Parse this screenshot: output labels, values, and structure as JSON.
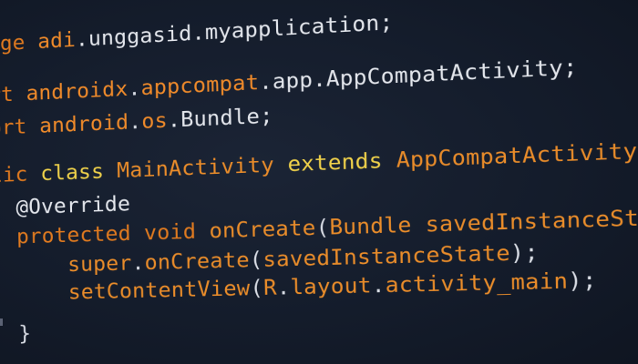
{
  "editor": {
    "lines": [
      {
        "id": "l1",
        "parts": [
          {
            "t": "age ",
            "c": "kw"
          },
          {
            "t": "adi",
            "c": "pk"
          },
          {
            "t": ".unggasid.myapplication;",
            "c": "id"
          }
        ]
      },
      {
        "id": "l2",
        "parts": [
          {
            "t": "rt ",
            "c": "kw"
          },
          {
            "t": "androidx",
            "c": "pk"
          },
          {
            "t": ".",
            "c": "pn"
          },
          {
            "t": "appcompat",
            "c": "pk"
          },
          {
            "t": ".app.AppCompatActivity;",
            "c": "id"
          }
        ]
      },
      {
        "id": "l3",
        "parts": [
          {
            "t": "ort ",
            "c": "kw"
          },
          {
            "t": "android",
            "c": "pk"
          },
          {
            "t": ".",
            "c": "pn"
          },
          {
            "t": "os",
            "c": "pk"
          },
          {
            "t": ".Bundle;",
            "c": "id"
          }
        ]
      },
      {
        "id": "l4",
        "parts": [
          {
            "t": "lic ",
            "c": "kw"
          },
          {
            "t": "class ",
            "c": "cls"
          },
          {
            "t": "MainActivity ",
            "c": "ty"
          },
          {
            "t": "extends ",
            "c": "cls"
          },
          {
            "t": "AppCompatActivity ",
            "c": "ty"
          },
          {
            "t": "{",
            "c": "pn"
          }
        ]
      },
      {
        "id": "l5",
        "parts": [
          {
            "t": "  @Override",
            "c": "an"
          }
        ]
      },
      {
        "id": "l6",
        "parts": [
          {
            "t": "  protected ",
            "c": "kw"
          },
          {
            "t": "void ",
            "c": "kw"
          },
          {
            "t": "onCreate",
            "c": "ty"
          },
          {
            "t": "(",
            "c": "pn"
          },
          {
            "t": "Bundle ",
            "c": "ty"
          },
          {
            "t": "savedInstanceState",
            "c": "ty"
          },
          {
            "t": ") {",
            "c": "pn"
          }
        ]
      },
      {
        "id": "l7",
        "parts": [
          {
            "t": "      super",
            "c": "ty"
          },
          {
            "t": ".",
            "c": "pn"
          },
          {
            "t": "onCreate",
            "c": "ty"
          },
          {
            "t": "(",
            "c": "pn"
          },
          {
            "t": "savedInstanceState",
            "c": "ty"
          },
          {
            "t": ");",
            "c": "pn"
          }
        ]
      },
      {
        "id": "l8",
        "parts": [
          {
            "t": "      setContentView",
            "c": "ty"
          },
          {
            "t": "(",
            "c": "pn"
          },
          {
            "t": "R",
            "c": "ty"
          },
          {
            "t": ".",
            "c": "pn"
          },
          {
            "t": "layout",
            "c": "ty"
          },
          {
            "t": ".",
            "c": "pn"
          },
          {
            "t": "activity_main",
            "c": "ty"
          },
          {
            "t": ");",
            "c": "pn"
          }
        ]
      },
      {
        "id": "l9",
        "parts": [
          {
            "t": "  }",
            "c": "pn"
          }
        ]
      }
    ],
    "colors": {
      "background": "#141c2b",
      "keyword": "#e07a1f",
      "type": "#e98c2a",
      "class_keyword": "#f0d24a",
      "identifier": "#e3e6ec"
    }
  }
}
